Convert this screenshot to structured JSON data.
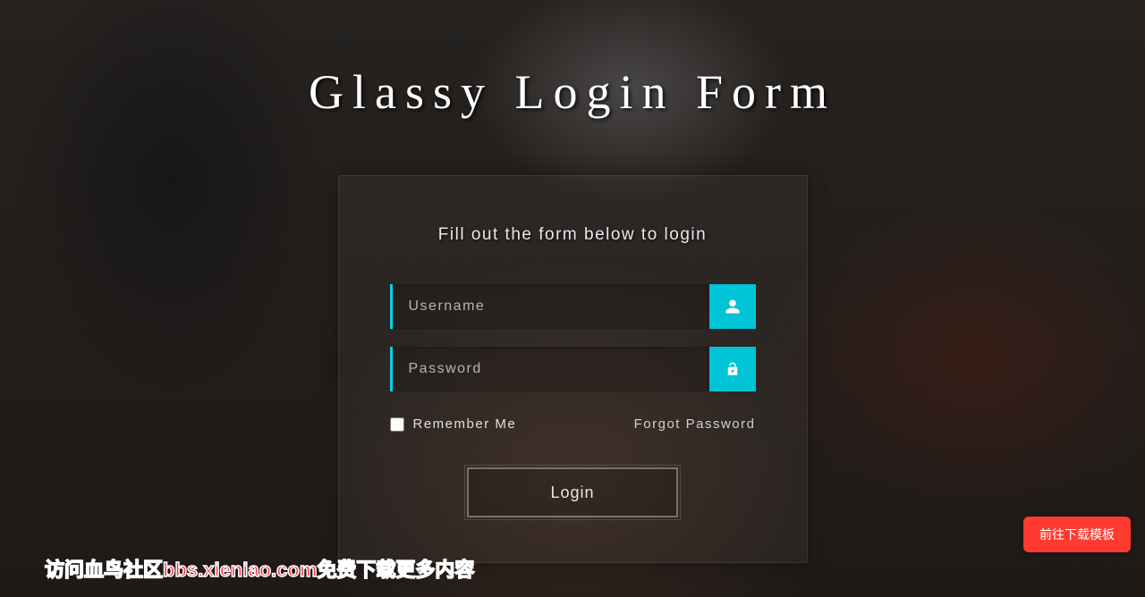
{
  "page": {
    "title": "Glassy Login Form"
  },
  "form": {
    "subtitle": "Fill out the form below to login",
    "username_placeholder": "Username",
    "password_placeholder": "Password",
    "remember_label": "Remember Me",
    "forgot_label": "Forgot Password",
    "login_button": "Login"
  },
  "overlay": {
    "watermark": "访问血鸟社区bbs.xieniao.com免费下载更多内容",
    "download_button": "前往下载模板"
  },
  "colors": {
    "accent": "#00c4d6",
    "danger": "#ff3a30"
  }
}
